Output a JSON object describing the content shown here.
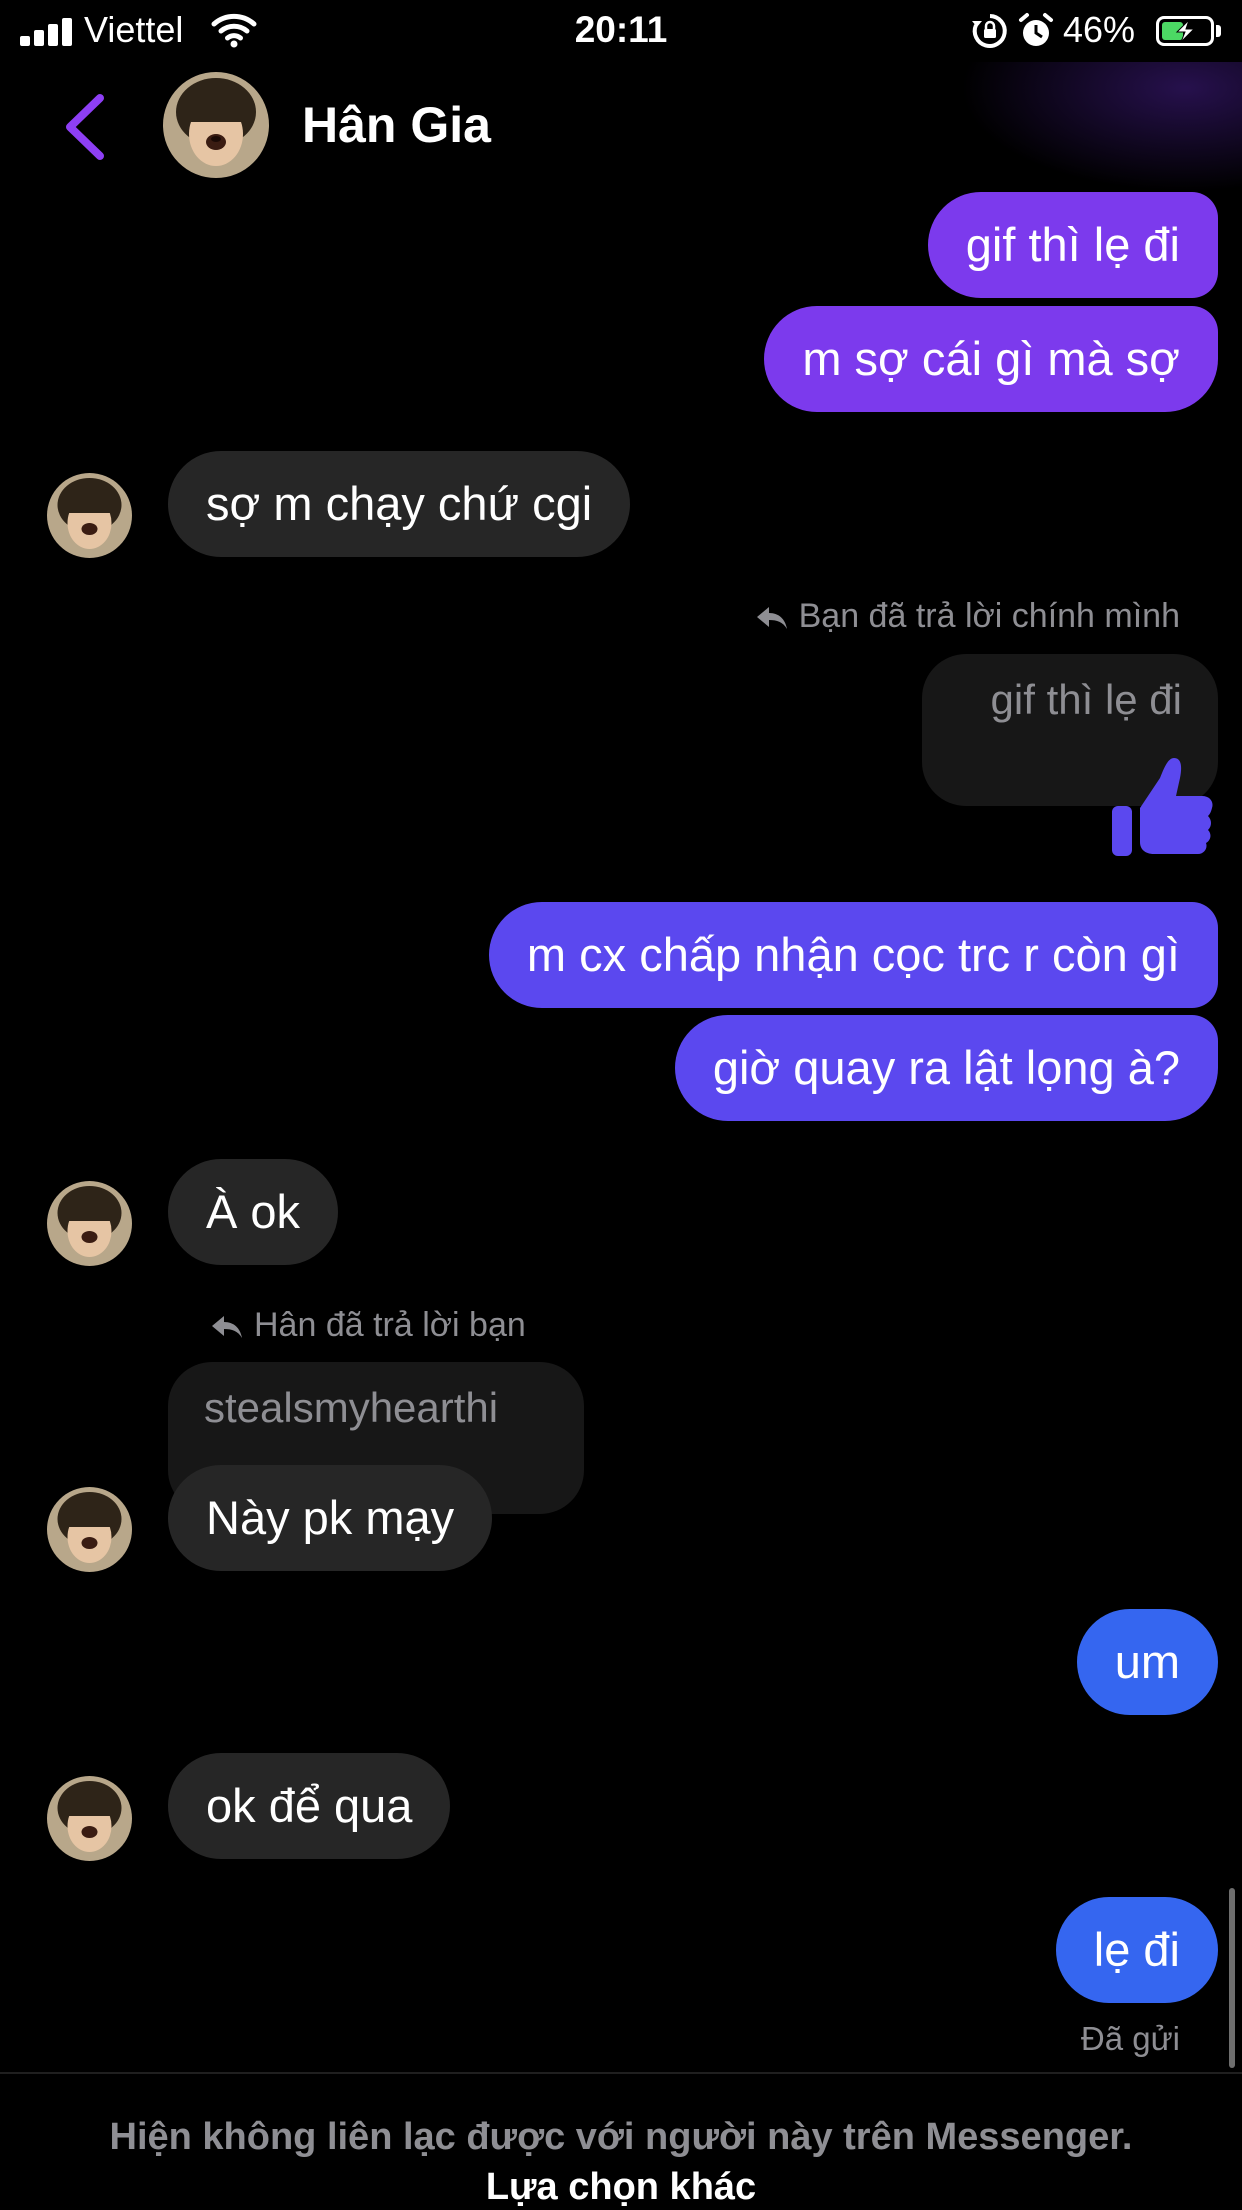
{
  "status_bar": {
    "carrier": "Viettel",
    "time": "20:11",
    "battery_percent": "46%",
    "battery_level": 0.46,
    "icons": [
      "signal-icon",
      "wifi-icon",
      "rotation-lock-icon",
      "alarm-icon",
      "battery-charging-icon"
    ]
  },
  "header": {
    "contact_name": "Hân Gia",
    "back_icon": "chevron-left-icon",
    "accent": "#8e3ff5"
  },
  "messages": {
    "m1": "gif thì lẹ đi",
    "m2": "m sợ cái gì mà sợ",
    "m3": "sợ m chạy chứ cgi",
    "reply1_label": "Bạn đã trả lời chính mình",
    "reply1_quote": "gif thì lẹ đi",
    "m5": "m cx chấp nhận cọc trc r còn gì",
    "m6": "giờ quay ra lật lọng à?",
    "m7": "À ok",
    "reply2_label": "Hân đã trả lời bạn",
    "reply2_quote": "stealsmyhearthi",
    "m8": "Này pk mạy",
    "m9": "um",
    "m10": "ok để qua",
    "m11": "lẹ đi",
    "sent_status": "Đã gửi"
  },
  "colors": {
    "outgoing_purple": "#7c3aed",
    "outgoing_indigo": "#5b48ef",
    "outgoing_blue": "#3566f0",
    "incoming": "#262626"
  },
  "footer": {
    "note": "Hiện không liên lạc được với người này trên Messenger.",
    "link": "Lựa chọn khác"
  }
}
